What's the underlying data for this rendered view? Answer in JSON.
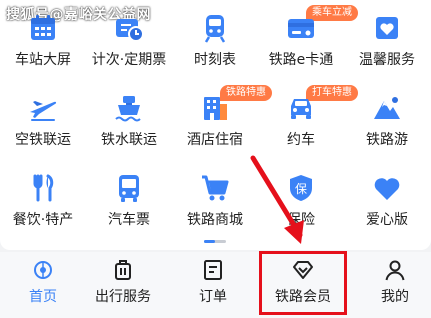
{
  "watermark": "搜狐号@嘉峪关公益网",
  "colors": {
    "accent": "#3b82f6",
    "badge": "#ff7a45",
    "highlight": "#e5101b"
  },
  "grid": {
    "rows": [
      [
        {
          "label": "车站大屏",
          "icon": "station-screen-icon"
        },
        {
          "label": "计次·定期票",
          "icon": "ticket-clock-icon"
        },
        {
          "label": "时刻表",
          "icon": "train-icon"
        },
        {
          "label": "铁路e卡通",
          "icon": "card-icon",
          "badge": "乘车立减"
        },
        {
          "label": "温馨服务",
          "icon": "heart-service-icon"
        }
      ],
      [
        {
          "label": "空铁联运",
          "icon": "plane-icon"
        },
        {
          "label": "铁水联运",
          "icon": "ship-icon"
        },
        {
          "label": "酒店住宿",
          "icon": "hotel-icon",
          "badge": "铁路特惠"
        },
        {
          "label": "约车",
          "icon": "car-icon",
          "badge": "打车特惠"
        },
        {
          "label": "铁路游",
          "icon": "mountain-icon"
        }
      ],
      [
        {
          "label": "餐饮·特产",
          "icon": "fork-knife-icon"
        },
        {
          "label": "汽车票",
          "icon": "bus-icon"
        },
        {
          "label": "铁路商城",
          "icon": "cart-icon"
        },
        {
          "label": "保险",
          "icon": "shield-icon",
          "badge_char": "保"
        },
        {
          "label": "爱心版",
          "icon": "heart-icon"
        }
      ]
    ]
  },
  "tabbar": {
    "items": [
      {
        "label": "首页",
        "icon": "home-icon",
        "active": true
      },
      {
        "label": "出行服务",
        "icon": "briefcase-icon",
        "active": false
      },
      {
        "label": "订单",
        "icon": "order-icon",
        "active": false
      },
      {
        "label": "铁路会员",
        "icon": "diamond-icon",
        "active": false
      },
      {
        "label": "我的",
        "icon": "user-icon",
        "active": false
      }
    ]
  }
}
